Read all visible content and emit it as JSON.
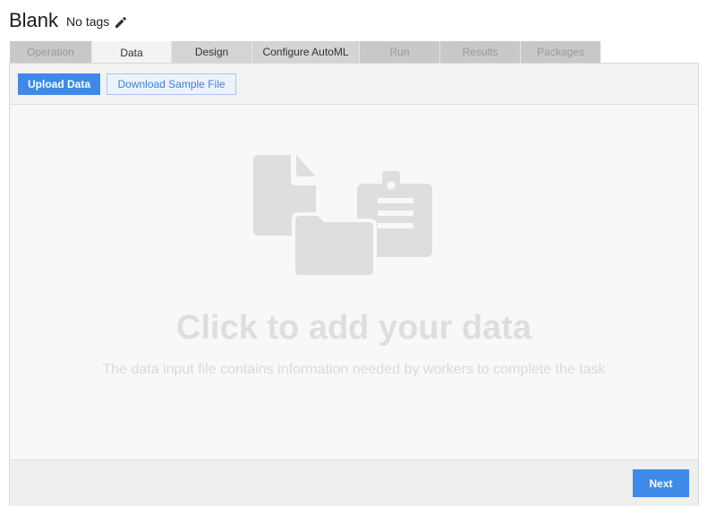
{
  "header": {
    "title": "Blank",
    "tags": "No tags",
    "edit_icon": "pencil-icon"
  },
  "tabs": [
    {
      "label": "Operation",
      "state": "disabled"
    },
    {
      "label": "Data",
      "state": "active"
    },
    {
      "label": "Design",
      "state": "enabled"
    },
    {
      "label": "Configure AutoML",
      "state": "enabled"
    },
    {
      "label": "Run",
      "state": "disabled"
    },
    {
      "label": "Results",
      "state": "disabled"
    },
    {
      "label": "Packages",
      "state": "disabled"
    }
  ],
  "toolbar": {
    "upload_label": "Upload Data",
    "sample_label": "Download Sample File"
  },
  "dropzone": {
    "illustration_icon": "data-files-icon",
    "cta": "Click to add your data",
    "hint": "The data input file contains information needed by workers to complete the task"
  },
  "footer": {
    "next_label": "Next"
  },
  "colors": {
    "accent": "#3f8ae9",
    "secondary_button_bg": "#eaf3ff",
    "secondary_button_text": "#3f7fd4"
  }
}
